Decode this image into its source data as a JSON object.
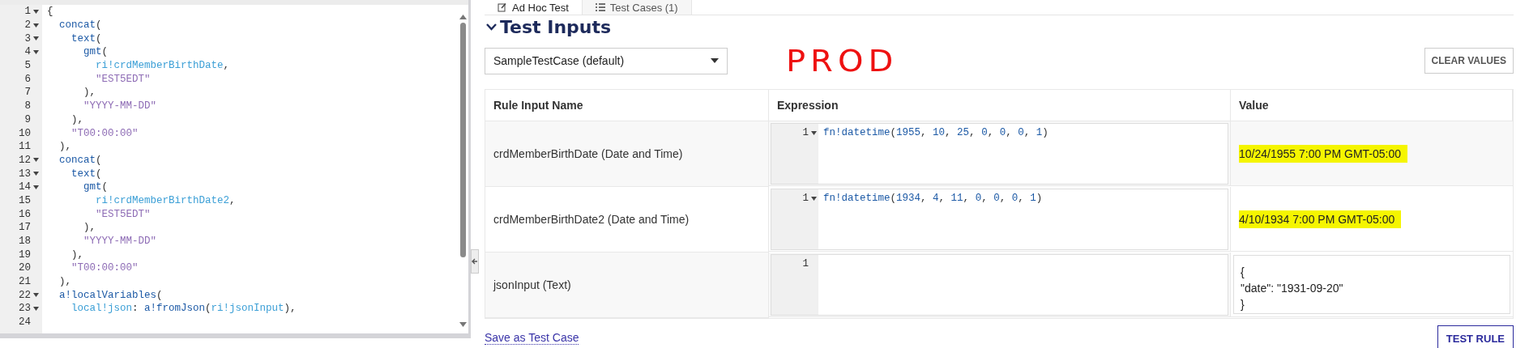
{
  "editor": {
    "lines": [
      {
        "number": "1",
        "foldable": true,
        "tokens": [
          {
            "kind": "punct",
            "text": "{"
          }
        ],
        "children": [
          {
            "number": "2",
            "foldable": true,
            "tokens": [
              {
                "kind": "fn",
                "text": "concat"
              },
              {
                "kind": "punct",
                "text": "("
              }
            ],
            "children": [
              {
                "number": "3",
                "foldable": true,
                "tokens": [
                  {
                    "kind": "fn",
                    "text": "text"
                  },
                  {
                    "kind": "punct",
                    "text": "("
                  }
                ],
                "children": [
                  {
                    "number": "4",
                    "foldable": true,
                    "tokens": [
                      {
                        "kind": "fn",
                        "text": "gmt"
                      },
                      {
                        "kind": "punct",
                        "text": "("
                      }
                    ],
                    "children": [
                      {
                        "number": "5",
                        "foldable": false,
                        "tokens": [
                          {
                            "kind": "var",
                            "text": "ri!crdMemberBirthDate"
                          },
                          {
                            "kind": "punct",
                            "text": ","
                          }
                        ]
                      },
                      {
                        "number": "6",
                        "foldable": false,
                        "tokens": [
                          {
                            "kind": "str",
                            "text": "\"EST5EDT\""
                          }
                        ]
                      }
                    ]
                  },
                  {
                    "number": "7",
                    "foldable": false,
                    "tokens": [
                      {
                        "kind": "punct",
                        "text": "),"
                      }
                    ]
                  },
                  {
                    "number": "8",
                    "foldable": false,
                    "tokens": [
                      {
                        "kind": "str",
                        "text": "\"YYYY-MM-DD\""
                      }
                    ]
                  }
                ]
              },
              {
                "number": "9",
                "foldable": false,
                "tokens": [
                  {
                    "kind": "punct",
                    "text": "),"
                  }
                ]
              },
              {
                "number": "10",
                "foldable": false,
                "tokens": [
                  {
                    "kind": "str",
                    "text": "\"T00:00:00\""
                  }
                ]
              }
            ]
          },
          {
            "number": "11",
            "foldable": false,
            "tokens": [
              {
                "kind": "punct",
                "text": "),"
              }
            ]
          },
          {
            "number": "12",
            "foldable": true,
            "tokens": [
              {
                "kind": "fn",
                "text": "concat"
              },
              {
                "kind": "punct",
                "text": "("
              }
            ],
            "children": [
              {
                "number": "13",
                "foldable": true,
                "tokens": [
                  {
                    "kind": "fn",
                    "text": "text"
                  },
                  {
                    "kind": "punct",
                    "text": "("
                  }
                ],
                "children": [
                  {
                    "number": "14",
                    "foldable": true,
                    "tokens": [
                      {
                        "kind": "fn",
                        "text": "gmt"
                      },
                      {
                        "kind": "punct",
                        "text": "("
                      }
                    ],
                    "children": [
                      {
                        "number": "15",
                        "foldable": false,
                        "tokens": [
                          {
                            "kind": "var",
                            "text": "ri!crdMemberBirthDate2"
                          },
                          {
                            "kind": "punct",
                            "text": ","
                          }
                        ]
                      },
                      {
                        "number": "16",
                        "foldable": false,
                        "tokens": [
                          {
                            "kind": "str",
                            "text": "\"EST5EDT\""
                          }
                        ]
                      }
                    ]
                  },
                  {
                    "number": "17",
                    "foldable": false,
                    "tokens": [
                      {
                        "kind": "punct",
                        "text": "),"
                      }
                    ]
                  },
                  {
                    "number": "18",
                    "foldable": false,
                    "tokens": [
                      {
                        "kind": "str",
                        "text": "\"YYYY-MM-DD\""
                      }
                    ]
                  }
                ]
              },
              {
                "number": "19",
                "foldable": false,
                "tokens": [
                  {
                    "kind": "punct",
                    "text": "),"
                  }
                ]
              },
              {
                "number": "20",
                "foldable": false,
                "tokens": [
                  {
                    "kind": "str",
                    "text": "\"T00:00:00\""
                  }
                ]
              }
            ]
          },
          {
            "number": "21",
            "foldable": false,
            "tokens": [
              {
                "kind": "punct",
                "text": "),"
              }
            ]
          },
          {
            "number": "22",
            "foldable": true,
            "tokens": [
              {
                "kind": "fn",
                "text": "a!localVariables"
              },
              {
                "kind": "punct",
                "text": "("
              }
            ],
            "children": [
              {
                "number": "23",
                "foldable": true,
                "tokens": [
                  {
                    "kind": "var",
                    "text": "local!json"
                  },
                  {
                    "kind": "punct",
                    "text": ":"
                  },
                  {
                    "kind": "fn",
                    "text": " a!fromJson"
                  },
                  {
                    "kind": "punct",
                    "text": "("
                  },
                  {
                    "kind": "var",
                    "text": "ri!jsonInput"
                  },
                  {
                    "kind": "punct",
                    "text": "),"
                  }
                ]
              },
              {
                "number": "24",
                "foldable": false
              }
            ]
          }
        ]
      }
    ]
  },
  "tabs": [
    {
      "label": "Ad Hoc Test",
      "selected": true
    },
    {
      "label": "Test Cases (1)",
      "selected": false
    }
  ],
  "section": {
    "title": "Test Inputs",
    "expanded": true
  },
  "test_case_select": {
    "value": "SampleTestCase (default)"
  },
  "annotation": "PROD",
  "clear_button": "CLEAR VALUES",
  "table": {
    "columns": [
      "Rule Input Name",
      "Expression",
      "Value"
    ],
    "rows": [
      {
        "name": "crdMemberBirthDate (Date and Time)",
        "expression": {
          "number": "1",
          "foldable": true,
          "tokens": [
            {
              "kind": "fn",
              "text": "fn!datetime"
            },
            {
              "kind": "punct",
              "text": "("
            },
            {
              "kind": "num",
              "text": "1955"
            },
            {
              "kind": "punct",
              "text": ", "
            },
            {
              "kind": "num",
              "text": "10"
            },
            {
              "kind": "punct",
              "text": ", "
            },
            {
              "kind": "num",
              "text": "25"
            },
            {
              "kind": "punct",
              "text": ", "
            },
            {
              "kind": "num",
              "text": "0"
            },
            {
              "kind": "punct",
              "text": ", "
            },
            {
              "kind": "num",
              "text": "0"
            },
            {
              "kind": "punct",
              "text": ", "
            },
            {
              "kind": "num",
              "text": "0"
            },
            {
              "kind": "punct",
              "text": ", "
            },
            {
              "kind": "num",
              "text": "1"
            },
            {
              "kind": "punct",
              "text": ")"
            }
          ]
        },
        "value": {
          "kind": "plain",
          "text": "10/24/1955 7:00 PM GMT-05:00",
          "highlighted": true
        }
      },
      {
        "name": "crdMemberBirthDate2 (Date and Time)",
        "expression": {
          "number": "1",
          "foldable": true,
          "tokens": [
            {
              "kind": "fn",
              "text": "fn!datetime"
            },
            {
              "kind": "punct",
              "text": "("
            },
            {
              "kind": "num",
              "text": "1934"
            },
            {
              "kind": "punct",
              "text": ", "
            },
            {
              "kind": "num",
              "text": "4"
            },
            {
              "kind": "punct",
              "text": ", "
            },
            {
              "kind": "num",
              "text": "11"
            },
            {
              "kind": "punct",
              "text": ", "
            },
            {
              "kind": "num",
              "text": "0"
            },
            {
              "kind": "punct",
              "text": ", "
            },
            {
              "kind": "num",
              "text": "0"
            },
            {
              "kind": "punct",
              "text": ", "
            },
            {
              "kind": "num",
              "text": "0"
            },
            {
              "kind": "punct",
              "text": ", "
            },
            {
              "kind": "num",
              "text": "1"
            },
            {
              "kind": "punct",
              "text": ")"
            }
          ]
        },
        "value": {
          "kind": "plain",
          "text": "4/10/1934 7:00 PM GMT-05:00",
          "highlighted": true
        }
      },
      {
        "name": "jsonInput (Text)",
        "expression": {
          "number": "1",
          "foldable": false
        },
        "value": {
          "kind": "field",
          "text": "{\n\"date\": \"1931-09-20\"\n}",
          "highlighted": false
        }
      }
    ]
  },
  "save_link": "Save as Test Case",
  "test_button": "TEST RULE"
}
